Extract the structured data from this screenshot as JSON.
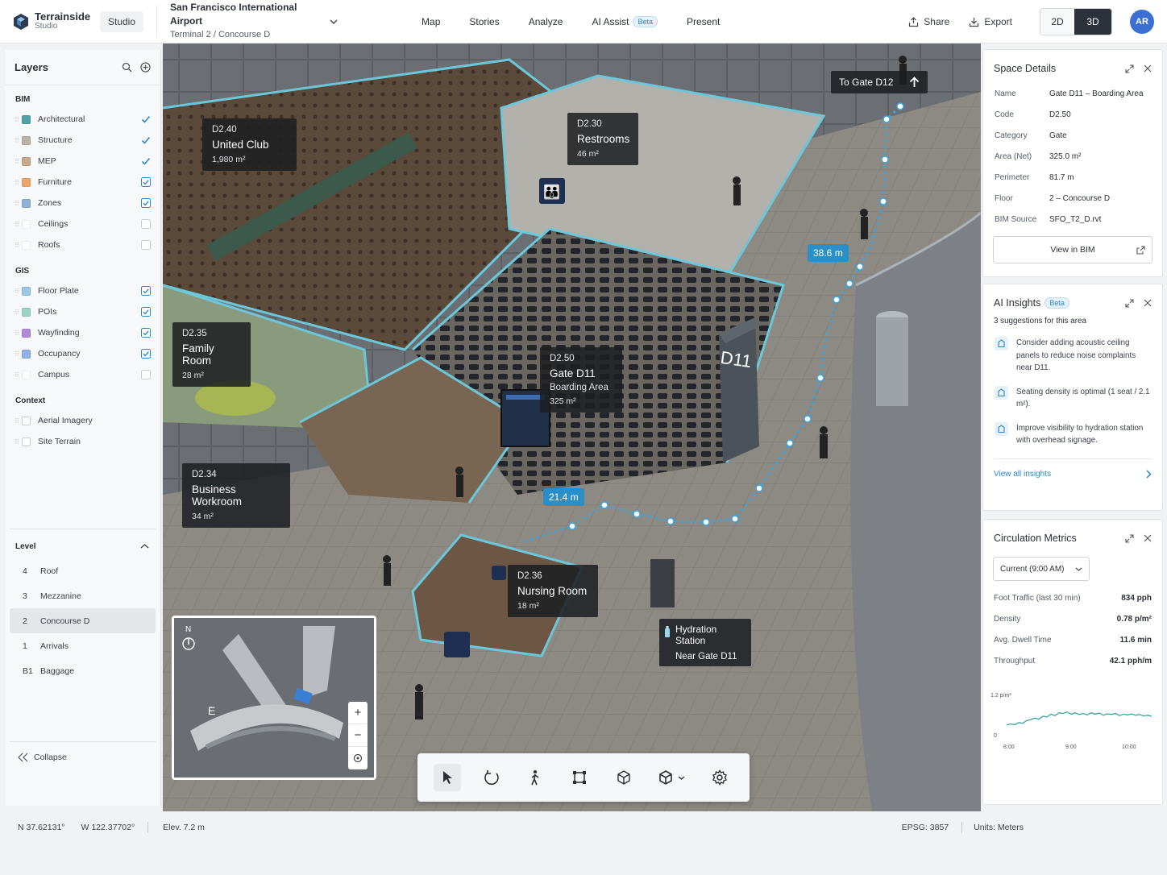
{
  "app": {
    "name": "Terrainside",
    "sub": "Studio",
    "workspace": "Studio"
  },
  "project": {
    "title": "San Francisco International Airport",
    "subtitle": "Terminal 2 / Concourse D"
  },
  "nav": [
    {
      "label": "Map"
    },
    {
      "label": "Stories"
    },
    {
      "label": "Analyze"
    },
    {
      "label": "AI Assist",
      "badge": "Beta"
    },
    {
      "label": "Present"
    }
  ],
  "toolbar": {
    "share": "Share",
    "export": "Export",
    "view_2d": "2D",
    "view_3d": "3D",
    "avatar": "AR"
  },
  "layers": {
    "title": "Layers",
    "bim_label": "BIM",
    "bim": [
      {
        "label": "Architectural",
        "color": "#4fa3a8",
        "checked": true
      },
      {
        "label": "Structure",
        "color": "#b9b3a6",
        "checked": true
      },
      {
        "label": "MEP",
        "color": "#c9a98a",
        "checked": true
      },
      {
        "label": "Furniture",
        "color": "#f0a46a",
        "checked": true
      },
      {
        "label": "Zones",
        "color": "#8fb0d9",
        "checked": true
      },
      {
        "label": "Ceilings",
        "color": "#ffffff",
        "checked": false
      },
      {
        "label": "Roofs",
        "color": "#ffffff",
        "checked": false
      }
    ],
    "gis_label": "GIS",
    "gis": [
      {
        "label": "Floor Plate",
        "color": "#9ac7e3",
        "checked": true
      },
      {
        "label": "POIs",
        "color": "#9cd4c4",
        "checked": true
      },
      {
        "label": "Wayfinding",
        "color": "#b08ad9",
        "checked": true
      },
      {
        "label": "Occupancy",
        "color": "#8fb0e8",
        "checked": true
      },
      {
        "label": "Campus",
        "color": "#ffffff",
        "checked": false
      }
    ],
    "context_label": "Context",
    "context": [
      {
        "label": "Aerial Imagery",
        "checked": false
      },
      {
        "label": "Site Terrain",
        "checked": false
      }
    ]
  },
  "levels": {
    "title": "Level",
    "items": [
      {
        "num": "4",
        "label": "Roof"
      },
      {
        "num": "3",
        "label": "Mezzanine"
      },
      {
        "num": "2",
        "label": "Concourse D",
        "selected": true
      },
      {
        "num": "1",
        "label": "Arrivals"
      },
      {
        "num": "B1",
        "label": "Baggage"
      }
    ],
    "collapse": "Collapse"
  },
  "map_labels": {
    "united": {
      "code": "D2.40",
      "name": "United Club",
      "area": "1,980 m²"
    },
    "restrooms": {
      "code": "D2.30",
      "name": "Restrooms",
      "area": "46 m²"
    },
    "family": {
      "code": "D2.35",
      "name": "Family Room",
      "area": "28 m²"
    },
    "gate": {
      "code": "D2.50",
      "name": "Gate D11",
      "sub": "Boarding Area",
      "area": "325 m²"
    },
    "workroom": {
      "code": "D2.34",
      "name": "Business Workroom",
      "area": "34 m²"
    },
    "nursing": {
      "code": "D2.36",
      "name": "Nursing Room",
      "area": "18 m²"
    },
    "hydration": {
      "name": "Hydration Station",
      "sub": "Near Gate D11"
    },
    "to_gate": "To Gate D12",
    "dist1": "38.6 m",
    "dist2": "21.4 m",
    "gate_sign": "D11",
    "minimap_north": "N",
    "minimap_e": "E"
  },
  "space_details": {
    "title": "Space Details",
    "rows": [
      {
        "k": "Name",
        "v": "Gate D11 – Boarding Area"
      },
      {
        "k": "Code",
        "v": "D2.50"
      },
      {
        "k": "Category",
        "v": "Gate"
      },
      {
        "k": "Area (Net)",
        "v": "325.0 m²"
      },
      {
        "k": "Perimeter",
        "v": "81.7 m"
      },
      {
        "k": "Floor",
        "v": "2 – Concourse D"
      },
      {
        "k": "BIM Source",
        "v": "SFO_T2_D.rvt"
      }
    ],
    "button": "View in BIM"
  },
  "ai_insights": {
    "title": "AI Insights",
    "badge": "Beta",
    "summary": "3 suggestions for this area",
    "items": [
      "Consider adding acoustic ceiling panels to reduce noise complaints near D11.",
      "Seating density is optimal (1 seat / 2.1 m²).",
      "Improve visibility to hydration station with overhead signage."
    ],
    "link": "View all insights"
  },
  "circulation": {
    "title": "Circulation Metrics",
    "period": "Current (9:00 AM)",
    "rows": [
      {
        "k": "Foot Traffic (last 30 min)",
        "v": "834 pph"
      },
      {
        "k": "Density",
        "v": "0.78 p/m²"
      },
      {
        "k": "Avg. Dwell Time",
        "v": "11.6 min"
      },
      {
        "k": "Throughput",
        "v": "42.1 pph/m"
      }
    ],
    "chart_data": {
      "type": "line",
      "x_ticks": [
        "8:00",
        "9:00",
        "10:00"
      ],
      "y_top_label": "1.2 p/m²",
      "y_bottom_label": "0",
      "ylim": [
        0,
        1.2
      ],
      "values": [
        0.35,
        0.38,
        0.36,
        0.42,
        0.4,
        0.48,
        0.5,
        0.55,
        0.52,
        0.6,
        0.58,
        0.66,
        0.62,
        0.7,
        0.68,
        0.72,
        0.66,
        0.7,
        0.65,
        0.68,
        0.64,
        0.7,
        0.66,
        0.69,
        0.63,
        0.67,
        0.65,
        0.68,
        0.62,
        0.66,
        0.64,
        0.67,
        0.63,
        0.65,
        0.61,
        0.63,
        0.6
      ]
    }
  },
  "status": {
    "lat": "N 37.62131°",
    "lon": "W 122.37702°",
    "elev": "Elev. 7.2 m",
    "epsg": "EPSG: 3857",
    "units": "Units: Meters"
  }
}
